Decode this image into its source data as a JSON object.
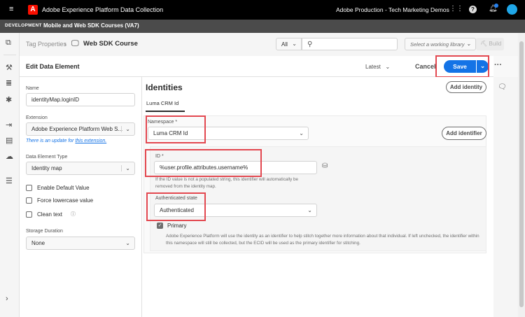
{
  "topbar": {
    "app_title": "Adobe Experience Platform Data Collection",
    "org": "Adobe Production - Tech Marketing Demos"
  },
  "devbar": {
    "env": "DEVELOPMENT",
    "property": "Mobile and Web SDK Courses (VA7)"
  },
  "breadcrumb": {
    "parent": "Tag Properties",
    "current": "Web SDK Course"
  },
  "toolbar": {
    "filter": "All",
    "search_placeholder": "",
    "library_placeholder": "Select a working library",
    "build": "Build"
  },
  "edit": {
    "title": "Edit Data Element",
    "version": "Latest",
    "cancel": "Cancel",
    "save": "Save"
  },
  "left": {
    "name_label": "Name",
    "name_value": "identityMap.loginID",
    "extension_label": "Extension",
    "extension_value": "Adobe Experience Platform Web S...",
    "update_text": "There is an update for ",
    "update_link": "this extension.",
    "type_label": "Data Element Type",
    "type_value": "Identity map",
    "checkboxes": [
      "Enable Default Value",
      "Force lowercase value",
      "Clean text"
    ],
    "storage_label": "Storage Duration",
    "storage_value": "None"
  },
  "main": {
    "heading": "Identities",
    "add_identity": "Add identity",
    "tab": "Luma CRM Id",
    "namespace_label": "Namespace",
    "namespace_value": "Luma CRM Id",
    "add_identifier": "Add identifier",
    "id_label": "ID",
    "id_value": "%user.profile.attributes.username%",
    "id_help": "If the ID value is not a populated string, this identifier will automatically be removed from the identity map.",
    "auth_label": "Authenticated state",
    "auth_value": "Authenticated",
    "primary_label": "Primary",
    "primary_help": "Adobe Experience Platform will use the identity as an identifier to help stitch together more information about that individual. If left unchecked, the identifier within this namespace will still be collected, but the ECID will be used as the primary identifier for stitching.",
    "required": "*"
  },
  "colors": {
    "accent": "#1473e6",
    "highlight": "#e34850",
    "adobe": "#fa0f00"
  }
}
